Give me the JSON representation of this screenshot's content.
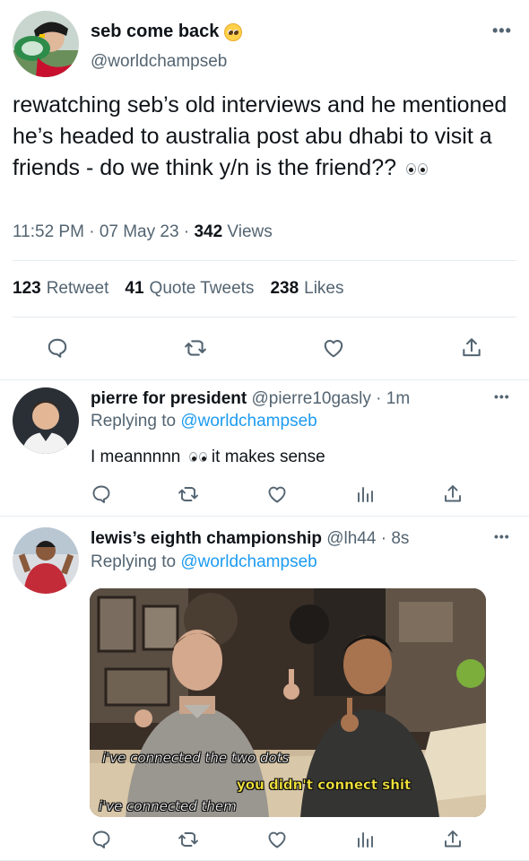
{
  "main_tweet": {
    "display_name": "seb come back",
    "name_emoji": "pleading-face-emoji",
    "handle": "@worldchampseb",
    "text": "rewatching seb’s old interviews and he mentioned he’s headed to australia post abu dhabi to visit a friends - do we think y/n is the friend??",
    "text_emoji": "eyes-emoji",
    "time": "11:52 PM",
    "date": "07 May 23",
    "views_count": "342",
    "views_label": "Views",
    "retweets_count": "123",
    "retweets_label": "Retweet",
    "quotes_count": "41",
    "quotes_label": "Quote Tweets",
    "likes_count": "238",
    "likes_label": "Likes",
    "actions": [
      "reply-icon",
      "retweet-icon",
      "like-icon",
      "share-icon"
    ]
  },
  "replies": [
    {
      "display_name": "pierre for president",
      "handle": "@pierre10gasly",
      "time": "1m",
      "replying_label": "Replying to",
      "replying_handle": "@worldchampseb",
      "text_before": "I meannnnn",
      "text_emoji": "eyes-emoji",
      "text_after": "it makes sense",
      "actions": [
        "reply-icon",
        "retweet-icon",
        "like-icon",
        "analytics-icon",
        "share-icon"
      ]
    },
    {
      "display_name": "lewis’s eighth championship",
      "handle": "@lh44",
      "time": "8s",
      "replying_label": "Replying to",
      "replying_handle": "@worldchampseb",
      "media_captions": [
        "i've connected the two dots",
        "you didn't connect shit",
        "i've connected them"
      ],
      "actions": [
        "reply-icon",
        "retweet-icon",
        "like-icon",
        "analytics-icon",
        "share-icon"
      ]
    }
  ],
  "colors": {
    "link": "#1d9bf0",
    "muted": "#536471",
    "text": "#0f1419",
    "divider": "#e6ecf0"
  }
}
